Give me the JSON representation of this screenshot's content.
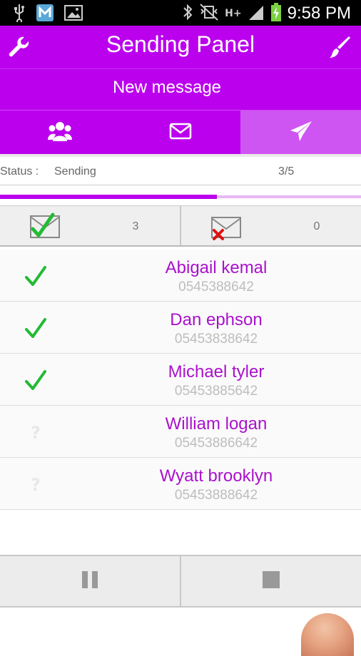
{
  "status_bar": {
    "time": "9:58 PM",
    "network": "H+"
  },
  "header": {
    "title": "Sending Panel",
    "left_icon": "wrench-icon",
    "right_icon": "brush-icon"
  },
  "subheader": {
    "text": "New message"
  },
  "tabs": [
    {
      "icon": "group-icon",
      "active": false
    },
    {
      "icon": "envelope-icon",
      "active": false
    },
    {
      "icon": "send-icon",
      "active": true
    }
  ],
  "status": {
    "label": "Status :",
    "value": "Sending",
    "count": "3/5",
    "progress_fraction": 0.6
  },
  "counters": {
    "sent": "3",
    "failed": "0"
  },
  "contacts": [
    {
      "name": "Abigail kemal",
      "phone": "0545388642",
      "state": "sent"
    },
    {
      "name": "Dan ephson",
      "phone": "05453838642",
      "state": "sent"
    },
    {
      "name": "Michael tyler",
      "phone": "05453885642",
      "state": "sent"
    },
    {
      "name": "William logan",
      "phone": "05453886642",
      "state": "pending"
    },
    {
      "name": "Wyatt brooklyn",
      "phone": "05453888642",
      "state": "pending"
    }
  ],
  "pending_glyph": "?",
  "colors": {
    "accent": "#bb00ee",
    "accent_light": "#cf55f2",
    "name_text": "#aa11cc",
    "check": "#22bb33",
    "error": "#dd1111"
  }
}
